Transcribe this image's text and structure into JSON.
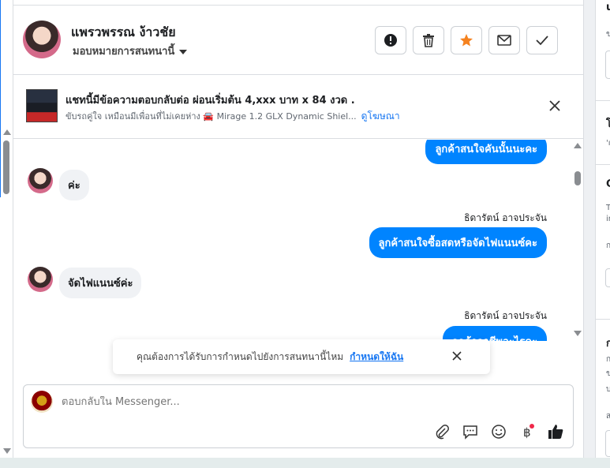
{
  "header": {
    "contact_name": "แพรวพรรณ ง้าวชัย",
    "assign_label": "มอบหมายการสนทนานี้",
    "buttons": [
      "report",
      "delete",
      "star",
      "mark-unread",
      "done"
    ]
  },
  "ad": {
    "title": "แชทนี้มีข้อความตอบกลับต่อ ผ่อนเริ่มต้น 4,xxx บาท x 84 งวด .",
    "subtitle": "ขับรถคู่ใจ เหมือนมีเพื่อนที่ไม่เคยห่าง 🚘 Mirage 1.2 GLX Dynamic Shiel...",
    "link": "ดูโฆษณา"
  },
  "messages": [
    {
      "side": "right",
      "text": "ลูกค้าสนใจคันนั้นนะคะ"
    },
    {
      "side": "left",
      "text": "ค่ะ"
    },
    {
      "side": "right",
      "sender": "ธิดารัตน์ อาจประจัน",
      "text": "ลูกค้าสนใจซื้อสดหรือจัดไฟแนนซ์คะ"
    },
    {
      "side": "left",
      "text": "จัดไฟแนนซ์ค่ะ"
    },
    {
      "side": "right",
      "sender": "ธิดารัตน์ อาจประจัน",
      "text": "ลูกค้าอาชีพอะไรคะ"
    }
  ],
  "toast": {
    "text": "คุณต้องการได้รับการกำหนดไปยังการสนทนานี้ไหม",
    "link": "กำหนดให้ฉัน"
  },
  "composer": {
    "placeholder": "ตอบกลับใน Messenger..."
  },
  "colors": {
    "accent": "#1877f2",
    "bubble": "#0084ff",
    "star": "#f5821f"
  }
}
